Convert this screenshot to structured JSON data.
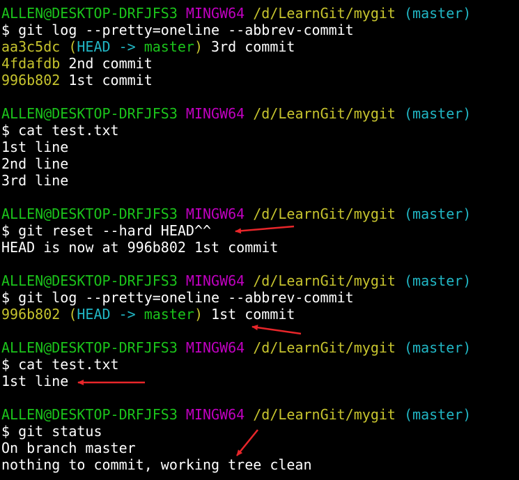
{
  "terminal": {
    "lines": [
      [
        {
          "t": "ALLEN@DESKTOP-DRFJFS3",
          "c": "green"
        },
        {
          "t": " ",
          "c": "white"
        },
        {
          "t": "MINGW64",
          "c": "magenta"
        },
        {
          "t": " ",
          "c": "white"
        },
        {
          "t": "/d/LearnGit/mygit",
          "c": "yellow"
        },
        {
          "t": " ",
          "c": "white"
        },
        {
          "t": "(master)",
          "c": "cyan"
        }
      ],
      [
        {
          "t": "$ git log --pretty=oneline --abbrev-commit",
          "c": "white"
        }
      ],
      [
        {
          "t": "aa3c5dc",
          "c": "yellow"
        },
        {
          "t": " ",
          "c": "white"
        },
        {
          "t": "(",
          "c": "yellow"
        },
        {
          "t": "HEAD -> ",
          "c": "cyan"
        },
        {
          "t": "master",
          "c": "green"
        },
        {
          "t": ")",
          "c": "yellow"
        },
        {
          "t": " 3rd commit",
          "c": "white"
        }
      ],
      [
        {
          "t": "4fdafdb",
          "c": "yellow"
        },
        {
          "t": " 2nd commit",
          "c": "white"
        }
      ],
      [
        {
          "t": "996b802",
          "c": "yellow"
        },
        {
          "t": " 1st commit",
          "c": "white"
        }
      ],
      [],
      [
        {
          "t": "ALLEN@DESKTOP-DRFJFS3",
          "c": "green"
        },
        {
          "t": " ",
          "c": "white"
        },
        {
          "t": "MINGW64",
          "c": "magenta"
        },
        {
          "t": " ",
          "c": "white"
        },
        {
          "t": "/d/LearnGit/mygit",
          "c": "yellow"
        },
        {
          "t": " ",
          "c": "white"
        },
        {
          "t": "(master)",
          "c": "cyan"
        }
      ],
      [
        {
          "t": "$ cat test.txt",
          "c": "white"
        }
      ],
      [
        {
          "t": "1st line",
          "c": "white"
        }
      ],
      [
        {
          "t": "2nd line",
          "c": "white"
        }
      ],
      [
        {
          "t": "3rd line",
          "c": "white"
        }
      ],
      [],
      [
        {
          "t": "ALLEN@DESKTOP-DRFJFS3",
          "c": "green"
        },
        {
          "t": " ",
          "c": "white"
        },
        {
          "t": "MINGW64",
          "c": "magenta"
        },
        {
          "t": " ",
          "c": "white"
        },
        {
          "t": "/d/LearnGit/mygit",
          "c": "yellow"
        },
        {
          "t": " ",
          "c": "white"
        },
        {
          "t": "(master)",
          "c": "cyan"
        }
      ],
      [
        {
          "t": "$ git reset --hard HEAD^^",
          "c": "white"
        }
      ],
      [
        {
          "t": "HEAD is now at 996b802 1st commit",
          "c": "white"
        }
      ],
      [],
      [
        {
          "t": "ALLEN@DESKTOP-DRFJFS3",
          "c": "green"
        },
        {
          "t": " ",
          "c": "white"
        },
        {
          "t": "MINGW64",
          "c": "magenta"
        },
        {
          "t": " ",
          "c": "white"
        },
        {
          "t": "/d/LearnGit/mygit",
          "c": "yellow"
        },
        {
          "t": " ",
          "c": "white"
        },
        {
          "t": "(master)",
          "c": "cyan"
        }
      ],
      [
        {
          "t": "$ git log --pretty=oneline --abbrev-commit",
          "c": "white"
        }
      ],
      [
        {
          "t": "996b802",
          "c": "yellow"
        },
        {
          "t": " ",
          "c": "white"
        },
        {
          "t": "(",
          "c": "yellow"
        },
        {
          "t": "HEAD -> ",
          "c": "cyan"
        },
        {
          "t": "master",
          "c": "green"
        },
        {
          "t": ")",
          "c": "yellow"
        },
        {
          "t": " 1st commit",
          "c": "white"
        }
      ],
      [],
      [
        {
          "t": "ALLEN@DESKTOP-DRFJFS3",
          "c": "green"
        },
        {
          "t": " ",
          "c": "white"
        },
        {
          "t": "MINGW64",
          "c": "magenta"
        },
        {
          "t": " ",
          "c": "white"
        },
        {
          "t": "/d/LearnGit/mygit",
          "c": "yellow"
        },
        {
          "t": " ",
          "c": "white"
        },
        {
          "t": "(master)",
          "c": "cyan"
        }
      ],
      [
        {
          "t": "$ cat test.txt",
          "c": "white"
        }
      ],
      [
        {
          "t": "1st line",
          "c": "white"
        }
      ],
      [],
      [
        {
          "t": "ALLEN@DESKTOP-DRFJFS3",
          "c": "green"
        },
        {
          "t": " ",
          "c": "white"
        },
        {
          "t": "MINGW64",
          "c": "magenta"
        },
        {
          "t": " ",
          "c": "white"
        },
        {
          "t": "/d/LearnGit/mygit",
          "c": "yellow"
        },
        {
          "t": " ",
          "c": "white"
        },
        {
          "t": "(master)",
          "c": "cyan"
        }
      ],
      [
        {
          "t": "$ git status",
          "c": "white"
        }
      ],
      [
        {
          "t": "On branch master",
          "c": "white"
        }
      ],
      [
        {
          "t": "nothing to commit, working tree clean",
          "c": "white"
        }
      ]
    ]
  },
  "annotations": {
    "arrow_color": "#e8262a",
    "arrows": [
      {
        "icon": "red-arrow-icon",
        "points_to": "HEAD^^"
      },
      {
        "icon": "red-arrow-icon",
        "points_to": "996b802 (HEAD -> master) 1st commit"
      },
      {
        "icon": "red-arrow-icon",
        "points_to": "1st line"
      },
      {
        "icon": "red-arrow-icon",
        "points_to": "working tree clean"
      }
    ]
  }
}
